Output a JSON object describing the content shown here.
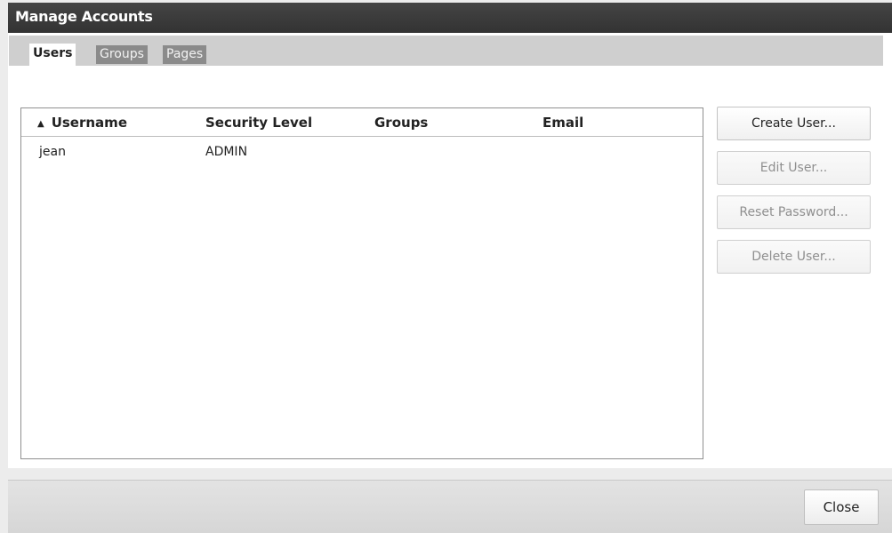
{
  "window": {
    "title": "Manage Accounts"
  },
  "tabs": [
    {
      "label": "Users",
      "active": true
    },
    {
      "label": "Groups",
      "active": false
    },
    {
      "label": "Pages",
      "active": false
    }
  ],
  "table": {
    "columns": [
      "Username",
      "Security Level",
      "Groups",
      "Email"
    ],
    "sort": {
      "column": "Username",
      "direction": "ascending"
    },
    "rows": [
      {
        "username": "jean",
        "security_level": "ADMIN",
        "groups": "",
        "email": ""
      }
    ]
  },
  "actions": {
    "create_user": {
      "label": "Create User...",
      "enabled": true
    },
    "edit_user": {
      "label": "Edit User...",
      "enabled": false
    },
    "reset_password": {
      "label": "Reset Password...",
      "enabled": false
    },
    "delete_user": {
      "label": "Delete User...",
      "enabled": false
    }
  },
  "footer": {
    "close_label": "Close"
  },
  "colors": {
    "titlebar": "#333333",
    "tab_inactive": "#8b8b8b",
    "tabstrip": "#cfcfcf"
  }
}
